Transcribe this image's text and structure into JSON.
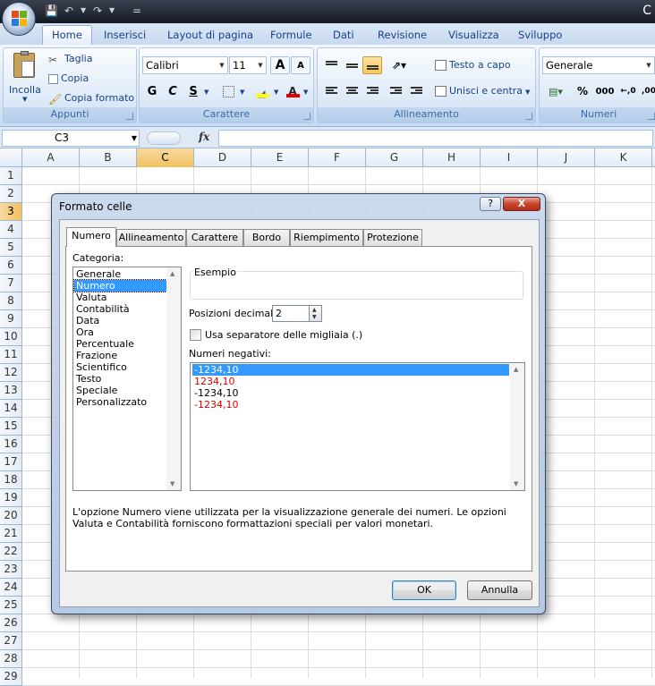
{
  "titlebar": {
    "title": "C",
    "qat_separator": "="
  },
  "ribbon_tabs": [
    "Home",
    "Inserisci",
    "Layout di pagina",
    "Formule",
    "Dati",
    "Revisione",
    "Visualizza",
    "Sviluppo"
  ],
  "clipboard": {
    "paste": "Incolla",
    "cut": "Taglia",
    "copy": "Copia",
    "format_painter": "Copia formato",
    "group": "Appunti"
  },
  "font": {
    "name": "Calibri",
    "size": "11",
    "bold": "G",
    "italic": "C",
    "underline": "S",
    "grow": "A",
    "shrink": "A",
    "group": "Carattere"
  },
  "alignment": {
    "wrap": "Testo a capo",
    "merge": "Unisci e centra",
    "group": "Allineamento"
  },
  "number": {
    "format": "Generale",
    "percent": "%",
    "thousands": "000",
    "group": "Numeri"
  },
  "formula_bar": {
    "name_box": "C3",
    "fx": "fx",
    "formula": ""
  },
  "grid": {
    "columns": [
      "A",
      "B",
      "C",
      "D",
      "E",
      "F",
      "G",
      "H",
      "I",
      "J",
      "K"
    ],
    "rows": [
      "1",
      "2",
      "3",
      "4",
      "5",
      "6",
      "7",
      "8",
      "9",
      "10",
      "11",
      "12",
      "13",
      "14",
      "15",
      "16",
      "17",
      "18",
      "19",
      "20",
      "21",
      "22",
      "23",
      "24",
      "25",
      "26",
      "27",
      "28",
      "29"
    ],
    "selected_column": "C",
    "selected_row": "3"
  },
  "dialog": {
    "title": "Formato celle",
    "help": "?",
    "close": "X",
    "tabs": [
      "Numero",
      "Allineamento",
      "Carattere",
      "Bordo",
      "Riempimento",
      "Protezione"
    ],
    "category_label": "Categoria:",
    "categories": [
      "Generale",
      "Numero",
      "Valuta",
      "Contabilità",
      "Data",
      "Ora",
      "Percentuale",
      "Frazione",
      "Scientifico",
      "Testo",
      "Speciale",
      "Personalizzato"
    ],
    "selected_category": "Numero",
    "sample_label": "Esempio",
    "decimals_label": "Posizioni decimali:",
    "decimals_value": "2",
    "thousands_label": "Usa separatore delle migliaia (.)",
    "thousands_checked": false,
    "negatives_label": "Numeri negativi:",
    "negative_formats": [
      {
        "text": "-1234,10",
        "color": "#000000"
      },
      {
        "text": "1234,10",
        "color": "#d40000"
      },
      {
        "text": "-1234,10",
        "color": "#000000"
      },
      {
        "text": "-1234,10",
        "color": "#d40000"
      }
    ],
    "description": "L'opzione Numero viene utilizzata per la visualizzazione generale dei numeri. Le opzioni Valuta e Contabilità forniscono formattazioni speciali per valori monetari.",
    "ok": "OK",
    "cancel": "Annulla"
  },
  "colors": {
    "accent": "#3399ff",
    "negative_red": "#d40000",
    "ribbon_text": "#15428b"
  }
}
